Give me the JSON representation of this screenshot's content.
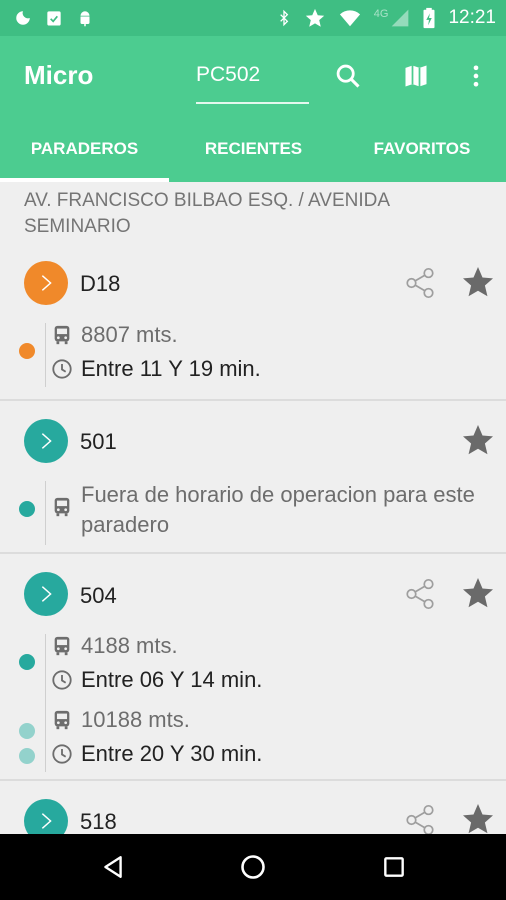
{
  "status_bar": {
    "time": "12:21",
    "network": "4G",
    "icons": [
      "moon-icon",
      "clipboard-check-icon",
      "android-icon",
      "bluetooth-icon",
      "star-icon",
      "wifi-icon",
      "signal-icon",
      "battery-charging-icon"
    ]
  },
  "app_bar": {
    "title": "Micro",
    "search_value": "PC502",
    "actions": [
      "search-icon",
      "map-icon",
      "more-vert-icon"
    ]
  },
  "tabs": [
    {
      "label": "PARADEROS",
      "selected": true
    },
    {
      "label": "RECIENTES",
      "selected": false
    },
    {
      "label": "FAVORITOS",
      "selected": false
    }
  ],
  "stop": {
    "name": "AV. FRANCISCO BILBAO ESQ. / AVENIDA SEMINARIO"
  },
  "routes": [
    {
      "number": "D18",
      "color": "#f0892a",
      "distance": "8807 mts.",
      "time": "Entre 11 Y 19 min."
    },
    {
      "number": "501",
      "color": "#27a99e",
      "note": "Fuera de horario de operacion para este paradero"
    },
    {
      "number": "504",
      "color": "#27a99e",
      "light_color": "#93d2cc",
      "arrivals": [
        {
          "distance": "4188 mts.",
          "time": "Entre 06 Y 14 min."
        },
        {
          "distance": "10188 mts.",
          "time": "Entre 20 Y 30 min."
        }
      ]
    },
    {
      "number": "518",
      "color": "#27a99e"
    }
  ],
  "colors": {
    "app_bar": "#4ccc90",
    "status_bar": "#3fbe83",
    "icon_gray": "#757575"
  }
}
